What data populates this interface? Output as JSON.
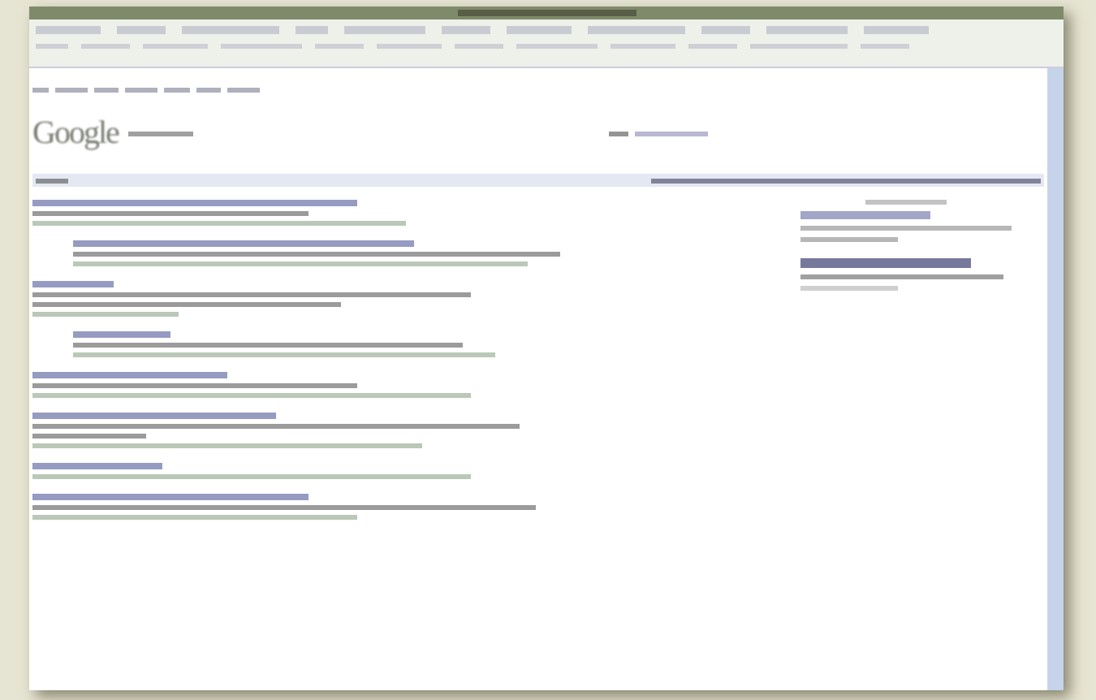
{
  "page": {
    "logo": "Google"
  }
}
